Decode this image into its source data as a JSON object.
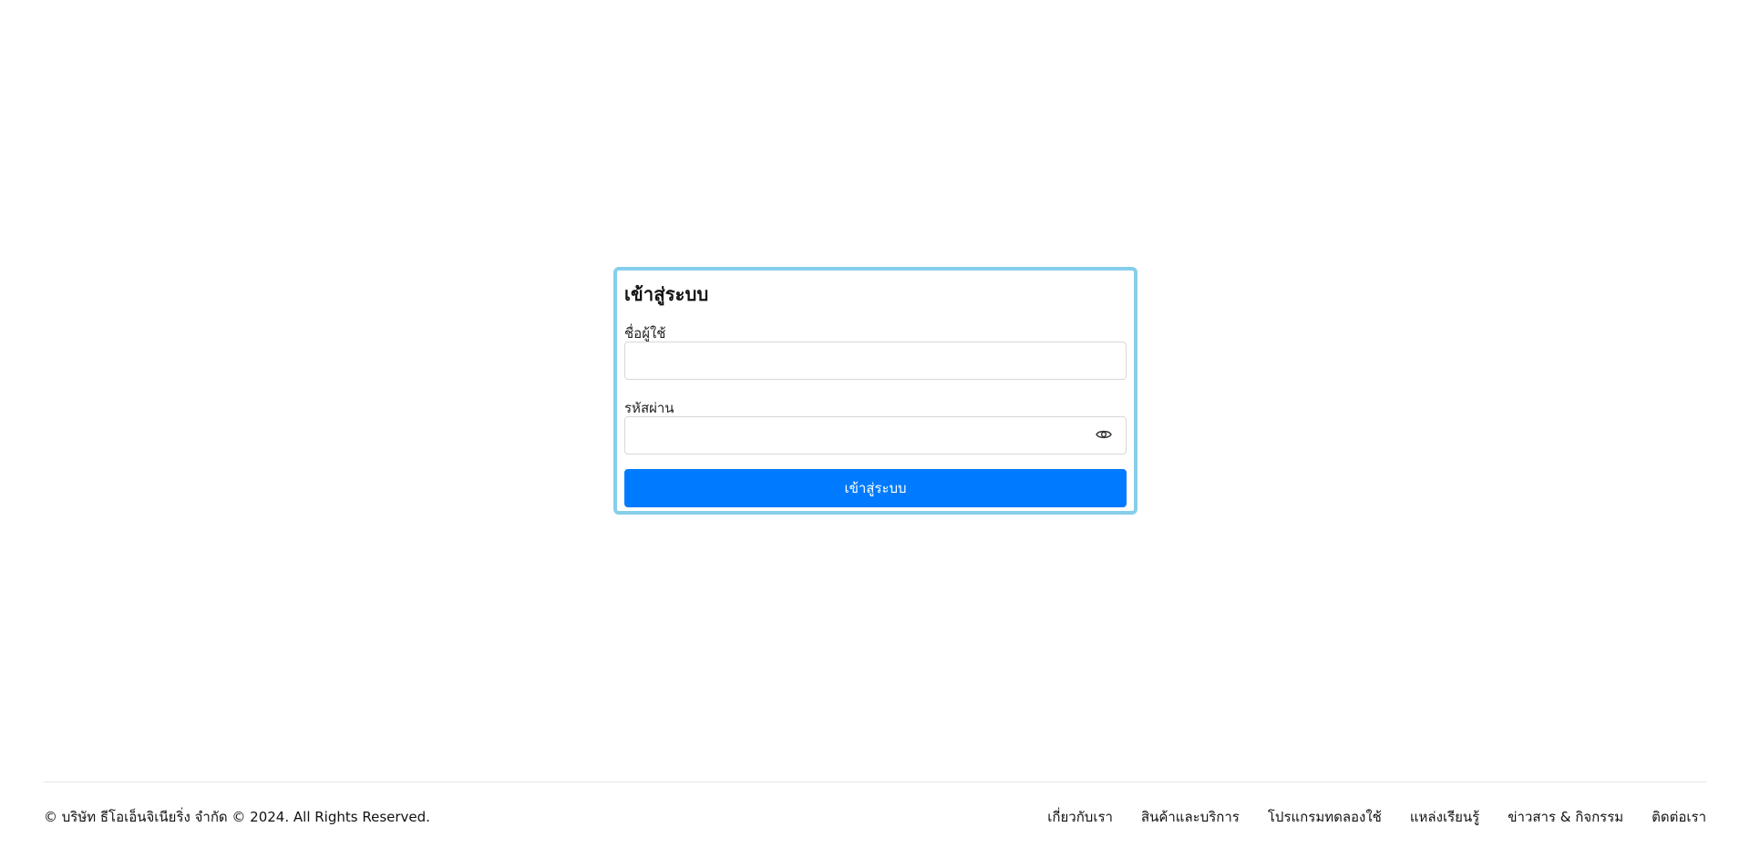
{
  "login": {
    "title": "เข้าสู่ระบบ",
    "username_label": "ชื่อผู้ใช้",
    "username_value": "",
    "username_placeholder": "",
    "password_label": "รหัสผ่าน",
    "password_value": "",
    "password_placeholder": "",
    "password_toggle_icon": "eye-icon",
    "submit_label": "เข้าสู่ระบบ"
  },
  "footer": {
    "copyright": "© บริษัท ธีโอเอ็นจิเนียริ่ง จำกัด © 2024. All Rights Reserved.",
    "links": [
      {
        "label": "เกี่ยวกับเรา"
      },
      {
        "label": "สินค้าและบริการ"
      },
      {
        "label": "โปรแกรมทดลองใช้"
      },
      {
        "label": "แหล่งเรียนรู้"
      },
      {
        "label": "ข่าวสาร & กิจกรรม"
      },
      {
        "label": "ติดต่อเรา"
      }
    ]
  },
  "colors": {
    "card_border": "#87ceeb",
    "primary_button": "#007bff",
    "footer_divider": "#e6e6e6"
  }
}
